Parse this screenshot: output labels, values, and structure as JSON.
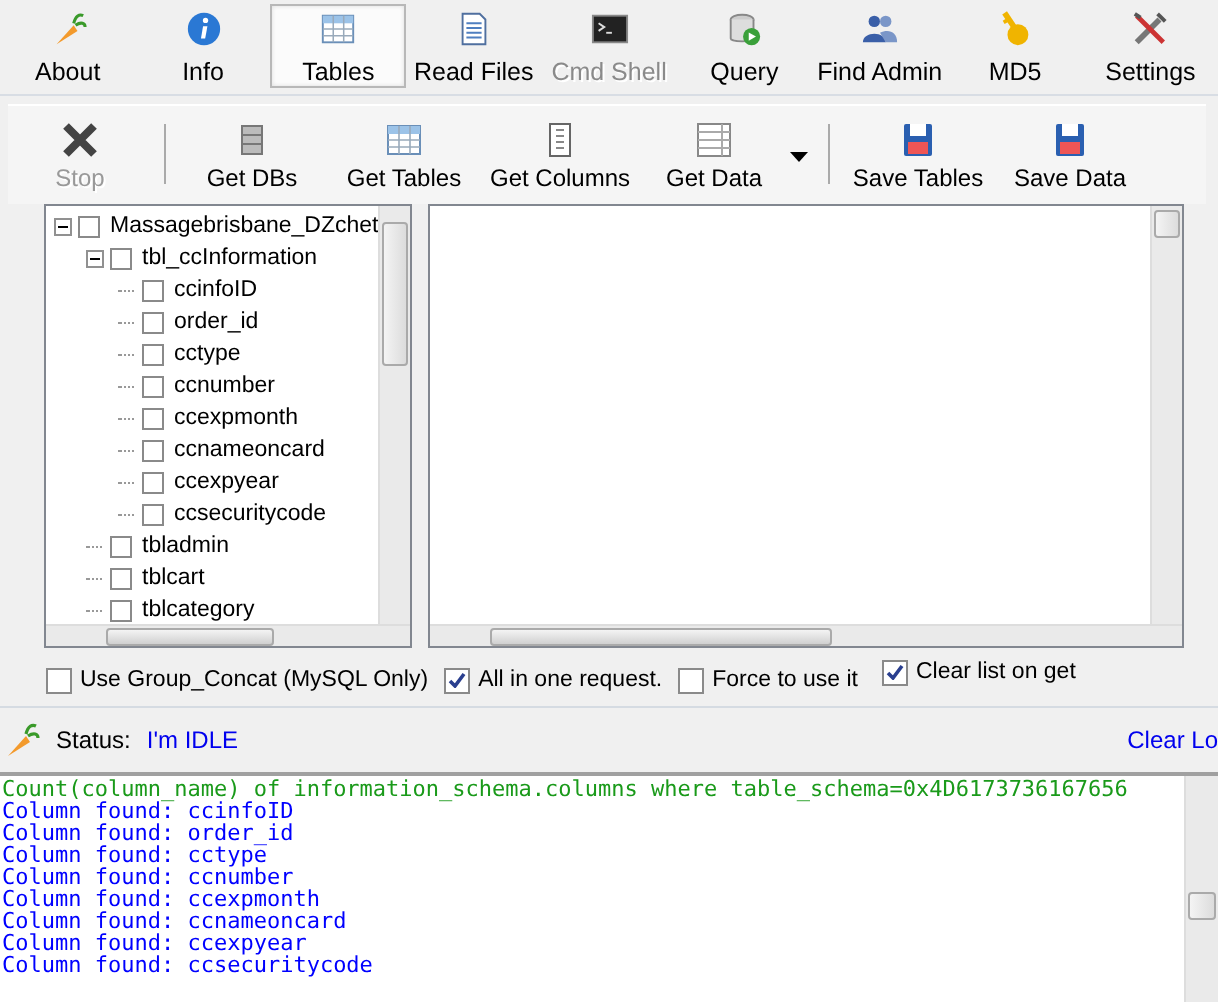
{
  "tabs": [
    {
      "label": "About",
      "selected": false,
      "disabled": false
    },
    {
      "label": "Info",
      "selected": false,
      "disabled": false
    },
    {
      "label": "Tables",
      "selected": true,
      "disabled": false
    },
    {
      "label": "Read Files",
      "selected": false,
      "disabled": false
    },
    {
      "label": "Cmd Shell",
      "selected": false,
      "disabled": true
    },
    {
      "label": "Query",
      "selected": false,
      "disabled": false
    },
    {
      "label": "Find Admin",
      "selected": false,
      "disabled": false
    },
    {
      "label": "MD5",
      "selected": false,
      "disabled": false
    },
    {
      "label": "Settings",
      "selected": false,
      "disabled": false
    }
  ],
  "toolbar": [
    {
      "kind": "button",
      "label": "Stop",
      "disabled": true
    },
    {
      "kind": "separator"
    },
    {
      "kind": "button",
      "label": "Get DBs",
      "disabled": false
    },
    {
      "kind": "button",
      "label": "Get Tables",
      "disabled": false
    },
    {
      "kind": "button",
      "label": "Get Columns",
      "disabled": false
    },
    {
      "kind": "button",
      "label": "Get Data",
      "disabled": false
    },
    {
      "kind": "dropdown"
    },
    {
      "kind": "separator"
    },
    {
      "kind": "button",
      "label": "Save Tables",
      "disabled": false
    },
    {
      "kind": "button",
      "label": "Save Data",
      "disabled": false
    }
  ],
  "tree": [
    {
      "label": "Massagebrisbane_DZchet",
      "checked": false,
      "expanded": true,
      "children": [
        {
          "label": "tbl_ccInformation",
          "checked": false,
          "expanded": true,
          "children": [
            {
              "label": "ccinfoID",
              "checked": false
            },
            {
              "label": "order_id",
              "checked": false
            },
            {
              "label": "cctype",
              "checked": false
            },
            {
              "label": "ccnumber",
              "checked": false
            },
            {
              "label": "ccexpmonth",
              "checked": false
            },
            {
              "label": "ccnameoncard",
              "checked": false
            },
            {
              "label": "ccexpyear",
              "checked": false
            },
            {
              "label": "ccsecuritycode",
              "checked": false
            }
          ]
        },
        {
          "label": "tbladmin",
          "checked": false
        },
        {
          "label": "tblcart",
          "checked": false
        },
        {
          "label": "tblcategory",
          "checked": false
        }
      ]
    }
  ],
  "options": [
    {
      "label": "Use Group_Concat (MySQL Only)",
      "checked": false
    },
    {
      "label": "All in one request.",
      "checked": true
    },
    {
      "label": "Force to use it",
      "checked": false
    },
    {
      "label": "Clear list on get",
      "checked": true
    }
  ],
  "status": {
    "label": "Status:",
    "value": "I'm IDLE",
    "link": "Clear Lo"
  },
  "log": [
    {
      "kind": "query",
      "text": "Count(column_name) of information_schema.columns where table_schema=0x4D6173736167656"
    },
    {
      "kind": "found",
      "text": "Column found: ccinfoID"
    },
    {
      "kind": "found",
      "text": "Column found: order_id"
    },
    {
      "kind": "found",
      "text": "Column found: cctype"
    },
    {
      "kind": "found",
      "text": "Column found: ccnumber"
    },
    {
      "kind": "found",
      "text": "Column found: ccexpmonth"
    },
    {
      "kind": "found",
      "text": "Column found: ccnameoncard"
    },
    {
      "kind": "found",
      "text": "Column found: ccexpyear"
    },
    {
      "kind": "found",
      "text": "Column found: ccsecuritycode"
    }
  ]
}
